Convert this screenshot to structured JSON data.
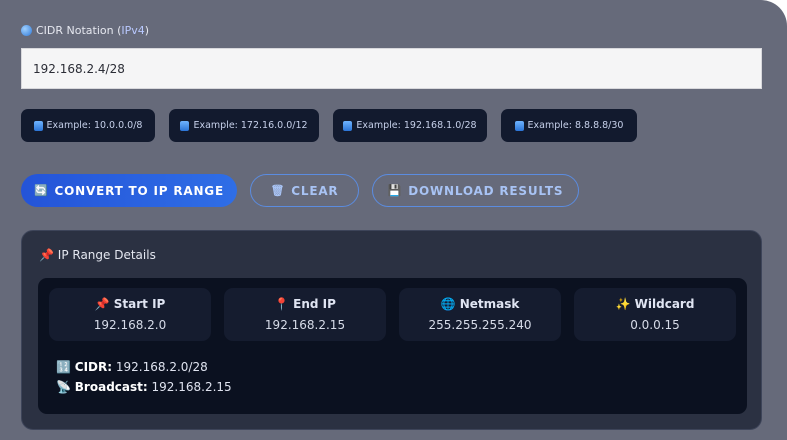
{
  "form": {
    "label_prefix": "CIDR Notation (",
    "label_highlight": "IPv4",
    "label_suffix": ")",
    "label_icon": "globe-icon",
    "input_value": "192.168.2.4/28"
  },
  "examples": [
    {
      "label": "Example: 10.0.0.0/8",
      "icon": "book-icon"
    },
    {
      "label": "Example: 172.16.0.0/12",
      "icon": "book-icon"
    },
    {
      "label": "Example: 192.168.1.0/28",
      "icon": "book-icon"
    },
    {
      "label": "Example: 8.8.8.8/30",
      "icon": "book-icon"
    }
  ],
  "actions": {
    "convert": {
      "label": "CONVERT TO IP RANGE",
      "glyph": "🔄",
      "icon": "refresh-icon"
    },
    "clear": {
      "label": "CLEAR",
      "glyph": "🗑",
      "icon": "trash-icon"
    },
    "download": {
      "label": "DOWNLOAD RESULTS",
      "glyph": "💾",
      "icon": "save-icon"
    }
  },
  "details": {
    "title_glyph": "📌",
    "title": "IP Range Details",
    "stats": [
      {
        "glyph": "📌",
        "label": "Start IP",
        "value": "192.168.2.0",
        "icon": "pushpin-icon"
      },
      {
        "glyph": "📍",
        "label": "End IP",
        "value": "192.168.2.15",
        "icon": "location-pin-icon"
      },
      {
        "glyph": "🌐",
        "label": "Netmask",
        "value": "255.255.255.240",
        "icon": "globe-icon"
      },
      {
        "glyph": "✨",
        "label": "Wildcard",
        "value": "0.0.0.15",
        "icon": "sparkles-icon"
      }
    ],
    "cidr": {
      "glyph": "🔢",
      "label": "CIDR:",
      "value": "192.168.2.0/28"
    },
    "broadcast": {
      "glyph": "📡",
      "label": "Broadcast:",
      "value": "192.168.2.15"
    }
  },
  "colors": {
    "panel_bg": "#666a7a",
    "chip_bg": "#121a2e",
    "primary_button": "#2454d8",
    "outline_button_border": "#5b8ce0",
    "details_bg": "#2b3142",
    "inner_bg": "#0b1120",
    "stat_bg": "#151c2f"
  }
}
